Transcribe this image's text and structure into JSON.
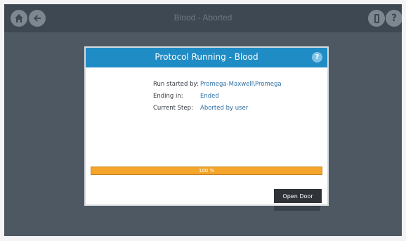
{
  "topbar": {
    "title": "Blood - Aborted",
    "icons": {
      "home": "home-icon",
      "back": "arrow-left-icon",
      "door": "door-icon",
      "help": "help-icon"
    },
    "help_glyph": "?"
  },
  "dialog": {
    "title": "Protocol Running - Blood",
    "help_glyph": "?",
    "info": [
      {
        "label": "Run started by:",
        "value": "Promega-Maxwell\\Promega"
      },
      {
        "label": "Ending in:",
        "value": "Ended"
      },
      {
        "label": "Current Step:",
        "value": "Aborted by user"
      }
    ],
    "progress": {
      "percent": 100,
      "label": "100 %"
    },
    "open_door_label": "Open Door"
  },
  "colors": {
    "header_blue": "#1f8cc6",
    "progress_orange": "#f4a52a",
    "value_blue": "#2d6fa3",
    "background_slate": "#4d5862"
  }
}
